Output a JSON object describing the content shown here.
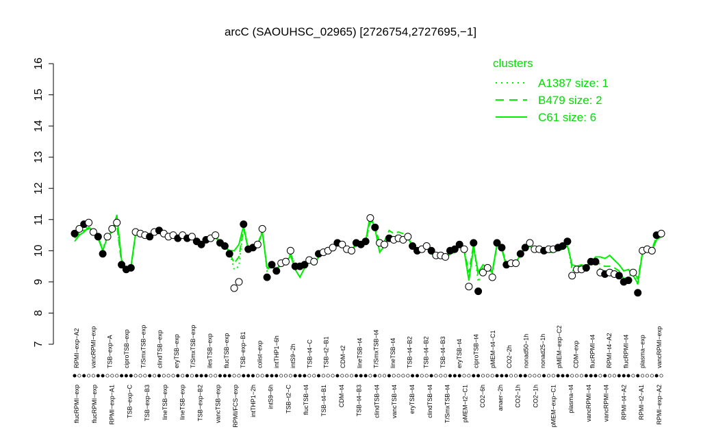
{
  "chart_data": {
    "type": "line",
    "title": "arcC (SAOUHSC_02965) [2726754,2727695,−1]",
    "xlabel": "",
    "ylabel": "",
    "ylim": [
      7,
      16
    ],
    "yticks": [
      7,
      8,
      9,
      10,
      11,
      12,
      13,
      14,
      15,
      16
    ],
    "legend": {
      "title": "clusters",
      "position": "top-right",
      "entries": [
        {
          "label": "A1387 size: 1",
          "style": "dotted"
        },
        {
          "label": "B479 size: 2",
          "style": "dashed"
        },
        {
          "label": "C61 size: 6",
          "style": "solid"
        }
      ]
    },
    "colors": {
      "cluster_line": "#00ee00",
      "legend_text": "#00dd00",
      "point_fill_dark": "#000000",
      "point_fill_light": "#ffffff"
    },
    "xlabels_top": [
      "RPMI−exp−A2",
      "vancRPMI−exp",
      "TSB−exp−A",
      "ciproTSB−exp",
      "T/SmxTSB−exp",
      "clindTSB−exp",
      "eryTSB−exp",
      "T/SmxTSB−exp",
      "ilesTSB−exp",
      "flucTSB−exp",
      "TSB−exp−B1",
      "colist−exp",
      "intTHP1−6h",
      "intS9−2h",
      "TSB−t4−C",
      "TSB−t2−B1",
      "CDM−t2",
      "lineTSB−t4",
      "T/SmxTSB−t4",
      "lineTSB−t4",
      "TSB−t4−B2",
      "TSB−t4−B2",
      "TSB−t4−B3",
      "eryTSB−t4",
      "ciproTSB−t4",
      "pMEM−t4−C1",
      "CO2−2h",
      "nonad50−1h",
      "nonad25−1h",
      "pMEM−exp−C2",
      "CDM−exp",
      "flucRPMI−t4",
      "RPMI−t4−A2",
      "flucRPMI−t4",
      "plasma−exp",
      "vancRPMI−exp"
    ],
    "xlabels_bottom": [
      "flucRPMI−exp",
      "flucRPMI−exp",
      "RPMI−exp−A1",
      "TSB−exp−C",
      "TSB−exp−B3",
      "lineTSB−exp",
      "lineTSB−exp",
      "TSB−exp−B2",
      "vancTSB−exp",
      "RPMI/FCS−exp",
      "intTHP1−2h",
      "intS9−6h",
      "TSB−t2−C",
      "flucTSB−t4",
      "TSB−t4−B1",
      "CDM−t4",
      "TSB−t4−B3",
      "clindTSB−t4",
      "vancTSB−t4",
      "eryTSB−t4",
      "clindTSB−t4",
      "T/SmxTSB−t4",
      "pMEM−t2−C1",
      "CO2−6h",
      "anaer−2h",
      "CO2−1h",
      "CO2−1h",
      "pMEM−exp−C1",
      "plasma−t4",
      "vancRPMI−t4",
      "vancRPMI−t4",
      "RPMI−t4−A2",
      "RPMI−t2−A1",
      "RPMI−exp−A2"
    ],
    "points": [
      {
        "x": 1,
        "y": 10.55,
        "f": 1
      },
      {
        "x": 2,
        "y": 10.7,
        "f": 0
      },
      {
        "x": 3,
        "y": 10.85,
        "f": 1
      },
      {
        "x": 4,
        "y": 10.9,
        "f": 0
      },
      {
        "x": 5,
        "y": 10.6,
        "f": 0
      },
      {
        "x": 6,
        "y": 10.45,
        "f": 1
      },
      {
        "x": 7,
        "y": 9.9,
        "f": 1
      },
      {
        "x": 8,
        "y": 10.45,
        "f": 0
      },
      {
        "x": 9,
        "y": 10.7,
        "f": 0
      },
      {
        "x": 10,
        "y": 10.9,
        "f": 0
      },
      {
        "x": 11,
        "y": 9.55,
        "f": 1
      },
      {
        "x": 12,
        "y": 9.4,
        "f": 1
      },
      {
        "x": 13,
        "y": 9.45,
        "f": 1
      },
      {
        "x": 14,
        "y": 10.6,
        "f": 0
      },
      {
        "x": 15,
        "y": 10.55,
        "f": 0
      },
      {
        "x": 16,
        "y": 10.5,
        "f": 0
      },
      {
        "x": 17,
        "y": 10.45,
        "f": 1
      },
      {
        "x": 18,
        "y": 10.6,
        "f": 0
      },
      {
        "x": 19,
        "y": 10.65,
        "f": 1
      },
      {
        "x": 20,
        "y": 10.55,
        "f": 0
      },
      {
        "x": 21,
        "y": 10.45,
        "f": 0
      },
      {
        "x": 22,
        "y": 10.5,
        "f": 0
      },
      {
        "x": 23,
        "y": 10.4,
        "f": 1
      },
      {
        "x": 24,
        "y": 10.5,
        "f": 0
      },
      {
        "x": 25,
        "y": 10.4,
        "f": 1
      },
      {
        "x": 26,
        "y": 10.45,
        "f": 0
      },
      {
        "x": 27,
        "y": 10.3,
        "f": 1
      },
      {
        "x": 28,
        "y": 10.2,
        "f": 1
      },
      {
        "x": 29,
        "y": 10.35,
        "f": 1
      },
      {
        "x": 30,
        "y": 10.4,
        "f": 0
      },
      {
        "x": 31,
        "y": 10.5,
        "f": 0
      },
      {
        "x": 32,
        "y": 10.25,
        "f": 1
      },
      {
        "x": 33,
        "y": 10.15,
        "f": 1
      },
      {
        "x": 34,
        "y": 9.9,
        "f": 1
      },
      {
        "x": 35,
        "y": 8.8,
        "f": 0
      },
      {
        "x": 36,
        "y": 9.0,
        "f": 0
      },
      {
        "x": 37,
        "y": 10.85,
        "f": 1
      },
      {
        "x": 38,
        "y": 10.05,
        "f": 1
      },
      {
        "x": 39,
        "y": 10.1,
        "f": 1
      },
      {
        "x": 40,
        "y": 10.2,
        "f": 0
      },
      {
        "x": 41,
        "y": 10.7,
        "f": 0
      },
      {
        "x": 42,
        "y": 9.15,
        "f": 1
      },
      {
        "x": 43,
        "y": 9.55,
        "f": 1
      },
      {
        "x": 44,
        "y": 9.35,
        "f": 1
      },
      {
        "x": 45,
        "y": 9.6,
        "f": 0
      },
      {
        "x": 46,
        "y": 9.65,
        "f": 0
      },
      {
        "x": 47,
        "y": 10.0,
        "f": 0
      },
      {
        "x": 48,
        "y": 9.5,
        "f": 1
      },
      {
        "x": 49,
        "y": 9.5,
        "f": 1
      },
      {
        "x": 50,
        "y": 9.55,
        "f": 1
      },
      {
        "x": 51,
        "y": 9.7,
        "f": 0
      },
      {
        "x": 52,
        "y": 9.65,
        "f": 0
      },
      {
        "x": 53,
        "y": 9.9,
        "f": 1
      },
      {
        "x": 54,
        "y": 9.95,
        "f": 0
      },
      {
        "x": 55,
        "y": 10.0,
        "f": 0
      },
      {
        "x": 56,
        "y": 10.1,
        "f": 0
      },
      {
        "x": 57,
        "y": 10.25,
        "f": 1
      },
      {
        "x": 58,
        "y": 10.2,
        "f": 0
      },
      {
        "x": 59,
        "y": 10.05,
        "f": 0
      },
      {
        "x": 60,
        "y": 10.0,
        "f": 0
      },
      {
        "x": 61,
        "y": 10.25,
        "f": 1
      },
      {
        "x": 62,
        "y": 10.2,
        "f": 1
      },
      {
        "x": 63,
        "y": 10.3,
        "f": 1
      },
      {
        "x": 64,
        "y": 11.05,
        "f": 0
      },
      {
        "x": 65,
        "y": 10.75,
        "f": 1
      },
      {
        "x": 66,
        "y": 10.25,
        "f": 0
      },
      {
        "x": 67,
        "y": 10.2,
        "f": 0
      },
      {
        "x": 68,
        "y": 10.4,
        "f": 1
      },
      {
        "x": 69,
        "y": 10.35,
        "f": 0
      },
      {
        "x": 70,
        "y": 10.4,
        "f": 0
      },
      {
        "x": 71,
        "y": 10.35,
        "f": 0
      },
      {
        "x": 72,
        "y": 10.45,
        "f": 0
      },
      {
        "x": 73,
        "y": 10.15,
        "f": 1
      },
      {
        "x": 74,
        "y": 10.0,
        "f": 1
      },
      {
        "x": 75,
        "y": 10.05,
        "f": 0
      },
      {
        "x": 76,
        "y": 10.15,
        "f": 0
      },
      {
        "x": 77,
        "y": 10.0,
        "f": 1
      },
      {
        "x": 78,
        "y": 9.85,
        "f": 0
      },
      {
        "x": 79,
        "y": 9.85,
        "f": 0
      },
      {
        "x": 80,
        "y": 9.8,
        "f": 0
      },
      {
        "x": 81,
        "y": 10.0,
        "f": 1
      },
      {
        "x": 82,
        "y": 10.05,
        "f": 1
      },
      {
        "x": 83,
        "y": 10.2,
        "f": 1
      },
      {
        "x": 84,
        "y": 10.05,
        "f": 0
      },
      {
        "x": 85,
        "y": 8.85,
        "f": 0
      },
      {
        "x": 86,
        "y": 10.25,
        "f": 1
      },
      {
        "x": 87,
        "y": 8.7,
        "f": 1
      },
      {
        "x": 88,
        "y": 9.3,
        "f": 0
      },
      {
        "x": 89,
        "y": 9.45,
        "f": 0
      },
      {
        "x": 90,
        "y": 9.15,
        "f": 0
      },
      {
        "x": 91,
        "y": 10.25,
        "f": 1
      },
      {
        "x": 92,
        "y": 10.1,
        "f": 1
      },
      {
        "x": 93,
        "y": 9.55,
        "f": 1
      },
      {
        "x": 94,
        "y": 9.6,
        "f": 0
      },
      {
        "x": 95,
        "y": 9.6,
        "f": 0
      },
      {
        "x": 96,
        "y": 9.9,
        "f": 1
      },
      {
        "x": 97,
        "y": 10.1,
        "f": 1
      },
      {
        "x": 98,
        "y": 10.25,
        "f": 0
      },
      {
        "x": 99,
        "y": 10.05,
        "f": 0
      },
      {
        "x": 100,
        "y": 10.05,
        "f": 0
      },
      {
        "x": 101,
        "y": 10.0,
        "f": 1
      },
      {
        "x": 102,
        "y": 10.05,
        "f": 0
      },
      {
        "x": 103,
        "y": 10.05,
        "f": 0
      },
      {
        "x": 104,
        "y": 10.1,
        "f": 1
      },
      {
        "x": 105,
        "y": 10.15,
        "f": 1
      },
      {
        "x": 106,
        "y": 10.3,
        "f": 1
      },
      {
        "x": 107,
        "y": 9.2,
        "f": 0
      },
      {
        "x": 108,
        "y": 9.4,
        "f": 0
      },
      {
        "x": 109,
        "y": 9.4,
        "f": 0
      },
      {
        "x": 110,
        "y": 9.45,
        "f": 1
      },
      {
        "x": 111,
        "y": 9.65,
        "f": 1
      },
      {
        "x": 112,
        "y": 9.65,
        "f": 1
      },
      {
        "x": 113,
        "y": 9.3,
        "f": 0
      },
      {
        "x": 114,
        "y": 9.25,
        "f": 1
      },
      {
        "x": 115,
        "y": 9.3,
        "f": 0
      },
      {
        "x": 116,
        "y": 9.25,
        "f": 0
      },
      {
        "x": 117,
        "y": 9.2,
        "f": 1
      },
      {
        "x": 118,
        "y": 9.0,
        "f": 1
      },
      {
        "x": 119,
        "y": 9.05,
        "f": 1
      },
      {
        "x": 120,
        "y": 9.3,
        "f": 0
      },
      {
        "x": 121,
        "y": 8.65,
        "f": 1
      },
      {
        "x": 122,
        "y": 10.0,
        "f": 0
      },
      {
        "x": 123,
        "y": 10.05,
        "f": 0
      },
      {
        "x": 124,
        "y": 10.0,
        "f": 0
      },
      {
        "x": 125,
        "y": 10.5,
        "f": 1
      },
      {
        "x": 126,
        "y": 10.55,
        "f": 0
      }
    ],
    "line_solid": [
      10.3,
      10.5,
      10.6,
      10.75,
      10.65,
      10.4,
      10.0,
      10.45,
      10.6,
      11.15,
      9.7,
      9.35,
      9.5,
      10.55,
      10.55,
      10.5,
      10.45,
      10.6,
      10.55,
      10.55,
      10.45,
      10.5,
      10.45,
      10.45,
      10.4,
      10.4,
      10.3,
      10.25,
      10.3,
      10.35,
      10.4,
      10.3,
      10.15,
      10.0,
      10.0,
      10.2,
      10.8,
      10.05,
      10.1,
      10.15,
      10.6,
      9.45,
      9.5,
      9.4,
      9.55,
      9.6,
      9.85,
      9.4,
      9.15,
      9.45,
      9.65,
      9.55,
      9.8,
      9.95,
      10.0,
      10.1,
      10.2,
      10.15,
      10.05,
      10.0,
      10.2,
      10.2,
      10.3,
      11.15,
      10.7,
      9.95,
      10.15,
      10.45,
      10.35,
      10.4,
      10.4,
      10.4,
      10.15,
      9.9,
      10.0,
      10.1,
      9.9,
      9.8,
      9.8,
      9.75,
      9.9,
      9.95,
      10.15,
      10.0,
      9.05,
      10.1,
      9.3,
      9.55,
      9.45,
      9.35,
      10.2,
      10.05,
      9.5,
      9.65,
      9.65,
      9.85,
      10.05,
      10.15,
      10.0,
      10.0,
      9.95,
      9.95,
      9.95,
      10.0,
      10.05,
      10.15,
      9.55,
      9.5,
      9.55,
      9.5,
      9.6,
      9.8,
      9.8,
      9.75,
      9.85,
      9.7,
      9.55,
      9.35,
      9.4,
      9.2,
      8.95,
      9.95,
      10.05,
      10.0,
      10.35,
      10.45
    ],
    "line_dashed": [
      10.4,
      10.55,
      10.65,
      10.7,
      10.55,
      10.45,
      10.0,
      10.5,
      10.7,
      10.8,
      9.6,
      9.45,
      9.45,
      10.55,
      10.55,
      10.45,
      10.45,
      10.55,
      10.6,
      10.55,
      10.45,
      10.5,
      10.45,
      10.5,
      10.4,
      10.45,
      10.35,
      10.2,
      10.3,
      10.4,
      10.5,
      10.25,
      10.15,
      9.95,
      9.6,
      9.8,
      10.7,
      10.05,
      10.1,
      10.2,
      10.65,
      9.4,
      9.5,
      9.4,
      9.6,
      9.6,
      9.9,
      9.55,
      9.4,
      9.5,
      9.65,
      9.6,
      9.85,
      9.95,
      10.0,
      10.1,
      10.25,
      10.2,
      10.05,
      10.0,
      10.25,
      10.2,
      10.3,
      10.95,
      10.75,
      10.25,
      10.3,
      10.65,
      10.55,
      10.6,
      10.55,
      10.55,
      10.15,
      10.0,
      10.05,
      10.1,
      10.0,
      9.85,
      9.85,
      9.8,
      9.95,
      10.05,
      10.2,
      10.05,
      9.3,
      10.2,
      9.2,
      9.45,
      9.4,
      9.3,
      10.2,
      10.1,
      9.55,
      9.6,
      9.6,
      9.9,
      10.1,
      10.25,
      10.05,
      10.05,
      10.0,
      10.05,
      10.05,
      10.1,
      10.1,
      10.25,
      9.45,
      9.5,
      9.5,
      9.5,
      9.65,
      9.7,
      9.55,
      9.5,
      9.5,
      9.45,
      9.35,
      9.1,
      9.15,
      9.35,
      9.1,
      9.95,
      10.0,
      10.05,
      10.45,
      10.5
    ],
    "line_dotted": [
      10.45,
      10.6,
      10.7,
      10.75,
      10.55,
      10.45,
      10.05,
      10.5,
      10.65,
      10.85,
      9.6,
      9.45,
      9.45,
      10.55,
      10.55,
      10.5,
      10.45,
      10.55,
      10.6,
      10.55,
      10.45,
      10.5,
      10.45,
      10.5,
      10.4,
      10.45,
      10.35,
      10.2,
      10.3,
      10.4,
      10.5,
      10.25,
      10.15,
      9.95,
      9.4,
      9.5,
      10.75,
      10.05,
      10.1,
      10.2,
      10.65,
      9.35,
      9.5,
      9.4,
      9.6,
      9.6,
      9.9,
      9.55,
      9.45,
      9.5,
      9.65,
      9.6,
      9.85,
      9.95,
      10.0,
      10.1,
      10.25,
      10.2,
      10.05,
      10.0,
      10.25,
      10.2,
      10.3,
      11.0,
      10.75,
      10.25,
      10.25,
      10.5,
      10.45,
      10.5,
      10.45,
      10.5,
      10.15,
      10.0,
      10.05,
      10.1,
      10.0,
      9.85,
      9.85,
      9.8,
      9.95,
      10.05,
      10.2,
      10.05,
      9.05,
      10.2,
      9.0,
      9.4,
      9.45,
      9.25,
      10.2,
      10.1,
      9.55,
      9.6,
      9.6,
      9.9,
      10.1,
      10.2,
      10.05,
      10.05,
      10.0,
      10.05,
      10.05,
      10.1,
      10.1,
      10.25,
      9.35,
      9.45,
      9.45,
      9.5,
      9.65,
      9.65,
      9.4,
      9.35,
      9.35,
      9.3,
      9.25,
      9.05,
      9.1,
      9.3,
      8.9,
      9.95,
      10.0,
      10.0,
      10.45,
      10.5
    ]
  }
}
